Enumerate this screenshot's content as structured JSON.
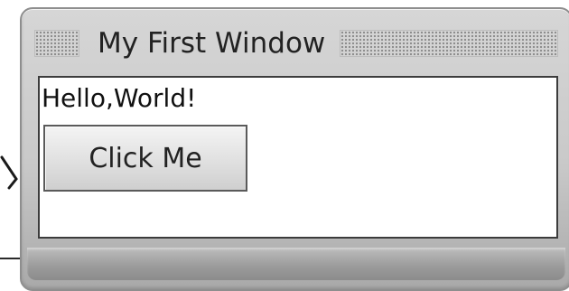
{
  "window": {
    "title": "My First Window"
  },
  "content": {
    "greeting": "Hello,World!",
    "button_label": "Click Me"
  },
  "colors": {
    "frame": "#c9c9c9",
    "client_background": "#ffffff",
    "text": "#222222"
  }
}
